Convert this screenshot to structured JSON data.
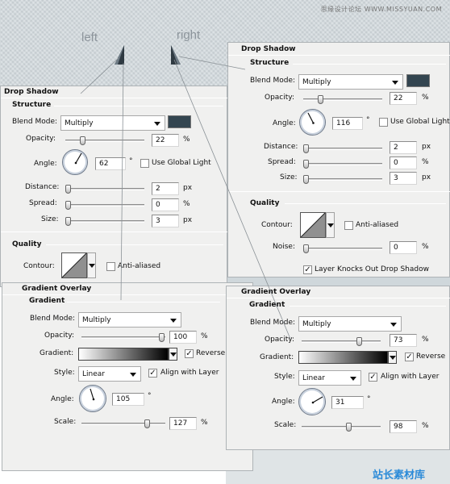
{
  "watermark": "思缘设计论坛  WWW.MISSYUAN.COM",
  "labels": {
    "left": "left",
    "right": "right"
  },
  "colors": {
    "shadow_swatch": "#334550"
  },
  "drop_shadow_left": {
    "title": "Drop Shadow",
    "structure_title": "Structure",
    "blend_mode_label": "Blend Mode:",
    "blend_mode_value": "Multiply",
    "opacity_label": "Opacity:",
    "opacity_value": "22",
    "opacity_unit": "%",
    "opacity_level": 0.22,
    "angle_label": "Angle:",
    "angle_value": "62",
    "angle_unit": "°",
    "global_light_label": "Use Global Light",
    "global_light_checked": false,
    "distance_label": "Distance:",
    "distance_value": "2",
    "distance_unit": "px",
    "spread_label": "Spread:",
    "spread_value": "0",
    "spread_unit": "%",
    "size_label": "Size:",
    "size_value": "3",
    "size_unit": "px",
    "quality_title": "Quality",
    "contour_label": "Contour:",
    "anti_aliased_label": "Anti-aliased",
    "anti_aliased_checked": false
  },
  "drop_shadow_right": {
    "title": "Drop Shadow",
    "structure_title": "Structure",
    "blend_mode_label": "Blend Mode:",
    "blend_mode_value": "Multiply",
    "opacity_label": "Opacity:",
    "opacity_value": "22",
    "opacity_unit": "%",
    "angle_label": "Angle:",
    "angle_value": "116",
    "angle_unit": "°",
    "global_light_label": "Use Global Light",
    "global_light_checked": false,
    "distance_label": "Distance:",
    "distance_value": "2",
    "distance_unit": "px",
    "spread_label": "Spread:",
    "spread_value": "0",
    "spread_unit": "%",
    "size_label": "Size:",
    "size_value": "3",
    "size_unit": "px",
    "quality_title": "Quality",
    "contour_label": "Contour:",
    "anti_aliased_label": "Anti-aliased",
    "anti_aliased_checked": false,
    "noise_label": "Noise:",
    "noise_value": "0",
    "noise_unit": "%",
    "layer_knocks_label": "Layer Knocks Out Drop Shadow",
    "layer_knocks_checked": true
  },
  "gradient_overlay_left": {
    "title": "Gradient Overlay",
    "section_title": "Gradient",
    "blend_mode_label": "Blend Mode:",
    "blend_mode_value": "Multiply",
    "opacity_label": "Opacity:",
    "opacity_value": "100",
    "opacity_unit": "%",
    "gradient_label": "Gradient:",
    "reverse_label": "Reverse",
    "reverse_checked": true,
    "style_label": "Style:",
    "style_value": "Linear",
    "align_label": "Align with Layer",
    "align_checked": true,
    "angle_label": "Angle:",
    "angle_value": "105",
    "angle_unit": "°",
    "scale_label": "Scale:",
    "scale_value": "127",
    "scale_unit": "%"
  },
  "gradient_overlay_right": {
    "title": "Gradient Overlay",
    "section_title": "Gradient",
    "blend_mode_label": "Blend Mode:",
    "blend_mode_value": "Multiply",
    "opacity_label": "Opacity:",
    "opacity_value": "73",
    "opacity_unit": "%",
    "gradient_label": "Gradient:",
    "reverse_label": "Reverse",
    "reverse_checked": true,
    "style_label": "Style:",
    "style_value": "Linear",
    "align_label": "Align with Layer",
    "align_checked": true,
    "angle_label": "Angle:",
    "angle_value": "31",
    "angle_unit": "°",
    "scale_label": "Scale:",
    "scale_value": "98",
    "scale_unit": "%"
  },
  "logo": "站长素材库"
}
